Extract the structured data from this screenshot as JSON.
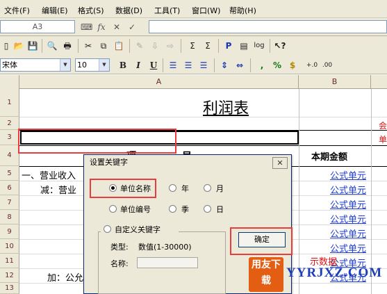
{
  "menu": [
    "文件(F)",
    "编辑(E)",
    "格式(S)",
    "数据(D)",
    "工具(T)",
    "窗口(W)",
    "帮助(H)"
  ],
  "formula_bar": {
    "cell_ref": "A3",
    "fx_label": "fx"
  },
  "toolbar2": {
    "font_name": "宋体",
    "font_size": "10"
  },
  "sheet": {
    "columns": [
      "A",
      "B"
    ],
    "rows": [
      "1",
      "2",
      "3",
      "4",
      "5",
      "6",
      "7",
      "8",
      "9",
      "10",
      "11",
      "12",
      "13"
    ],
    "title": "利润表",
    "a4_left": "项",
    "a4_right": "目",
    "b4_header": "本期金额",
    "a5": "一、营业收入",
    "a6": "减：营业",
    "a12": "加：公允",
    "c2_partial": "会",
    "c3_partial": "单",
    "formula_unit": "公式单元",
    "formula_rows": [
      "5",
      "6",
      "7",
      "8",
      "9",
      "10",
      "11",
      "12",
      "13"
    ],
    "demo_data_text": "示数据"
  },
  "dialog": {
    "title": "设置关键字",
    "close": "✕",
    "radios": [
      {
        "label": "单位名称",
        "checked": true
      },
      {
        "label": "年",
        "checked": false
      },
      {
        "label": "月",
        "checked": false
      },
      {
        "label": "单位编号",
        "checked": false
      },
      {
        "label": "季",
        "checked": false
      },
      {
        "label": "日",
        "checked": false
      }
    ],
    "custom_label": "自定义关键字",
    "type_label": "类型:",
    "type_value": "数值(1-30000)",
    "name_label": "名称:",
    "ok_label": "确定"
  },
  "watermark": {
    "badge": "用友下载",
    "site": "YYRJXZ.COM"
  },
  "colors": {
    "highlight": "#ea3c3c",
    "formula_link": "#1f3cd6",
    "chrome": "#ece9d8"
  }
}
